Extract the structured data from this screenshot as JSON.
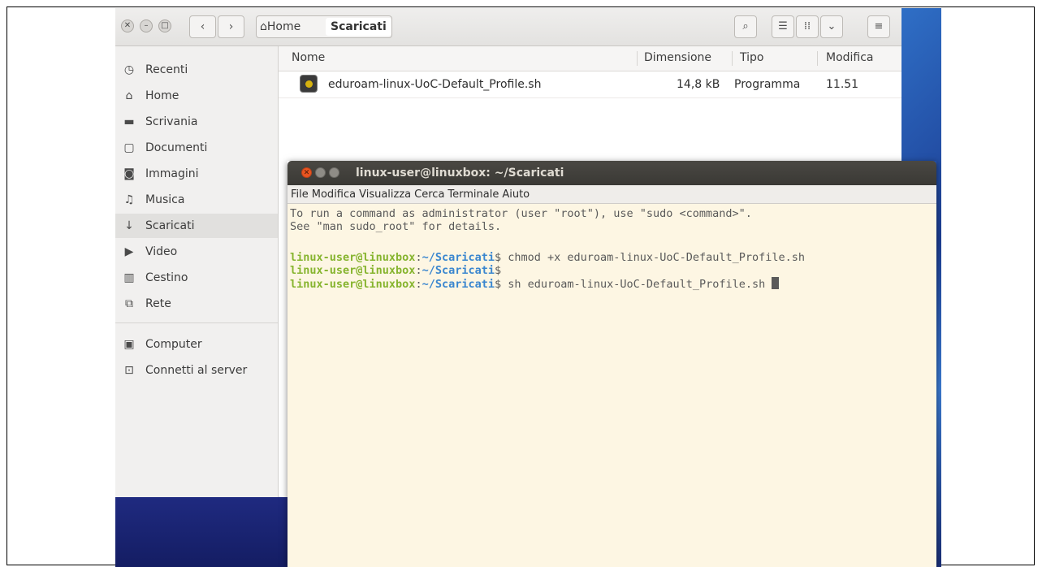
{
  "file_manager": {
    "path": {
      "home_label": "Home",
      "current_label": "Scaricati"
    },
    "sidebar": {
      "items": [
        {
          "label": "Recenti",
          "icon": "clock-icon"
        },
        {
          "label": "Home",
          "icon": "home-icon"
        },
        {
          "label": "Scrivania",
          "icon": "folder-icon"
        },
        {
          "label": "Documenti",
          "icon": "document-icon"
        },
        {
          "label": "Immagini",
          "icon": "camera-icon"
        },
        {
          "label": "Musica",
          "icon": "music-icon"
        },
        {
          "label": "Scaricati",
          "icon": "download-icon",
          "selected": true
        },
        {
          "label": "Video",
          "icon": "video-icon"
        },
        {
          "label": "Cestino",
          "icon": "trash-icon"
        },
        {
          "label": "Rete",
          "icon": "network-icon"
        },
        {
          "label": "Computer",
          "icon": "computer-icon"
        },
        {
          "label": "Connetti al server",
          "icon": "server-icon"
        }
      ]
    },
    "columns": {
      "name": "Nome",
      "size": "Dimensione",
      "type": "Tipo",
      "modified": "Modifica"
    },
    "files": [
      {
        "name": "eduroam-linux-UoC-Default_Profile.sh",
        "size": "14,8 kB",
        "type": "Programma",
        "modified": "11.51"
      }
    ]
  },
  "terminal": {
    "title": "linux-user@linuxbox: ~/Scaricati",
    "menu": [
      "File",
      "Modifica",
      "Visualizza",
      "Cerca",
      "Terminale",
      "Aiuto"
    ],
    "info_lines": [
      "To run a command as administrator (user \"root\"), use \"sudo <command>\".",
      "See \"man sudo_root\" for details."
    ],
    "prompt_user": "linux-user@linuxbox",
    "prompt_colon": ":",
    "prompt_path": "~/Scaricati",
    "prompt_dollar": "$",
    "commands": [
      " chmod +x eduroam-linux-UoC-Default_Profile.sh",
      "",
      " sh eduroam-linux-UoC-Default_Profile.sh "
    ]
  },
  "colors": {
    "prompt_user": "#86b42e",
    "prompt_path": "#3a86cf",
    "terminal_bg": "#fdf6e3"
  }
}
